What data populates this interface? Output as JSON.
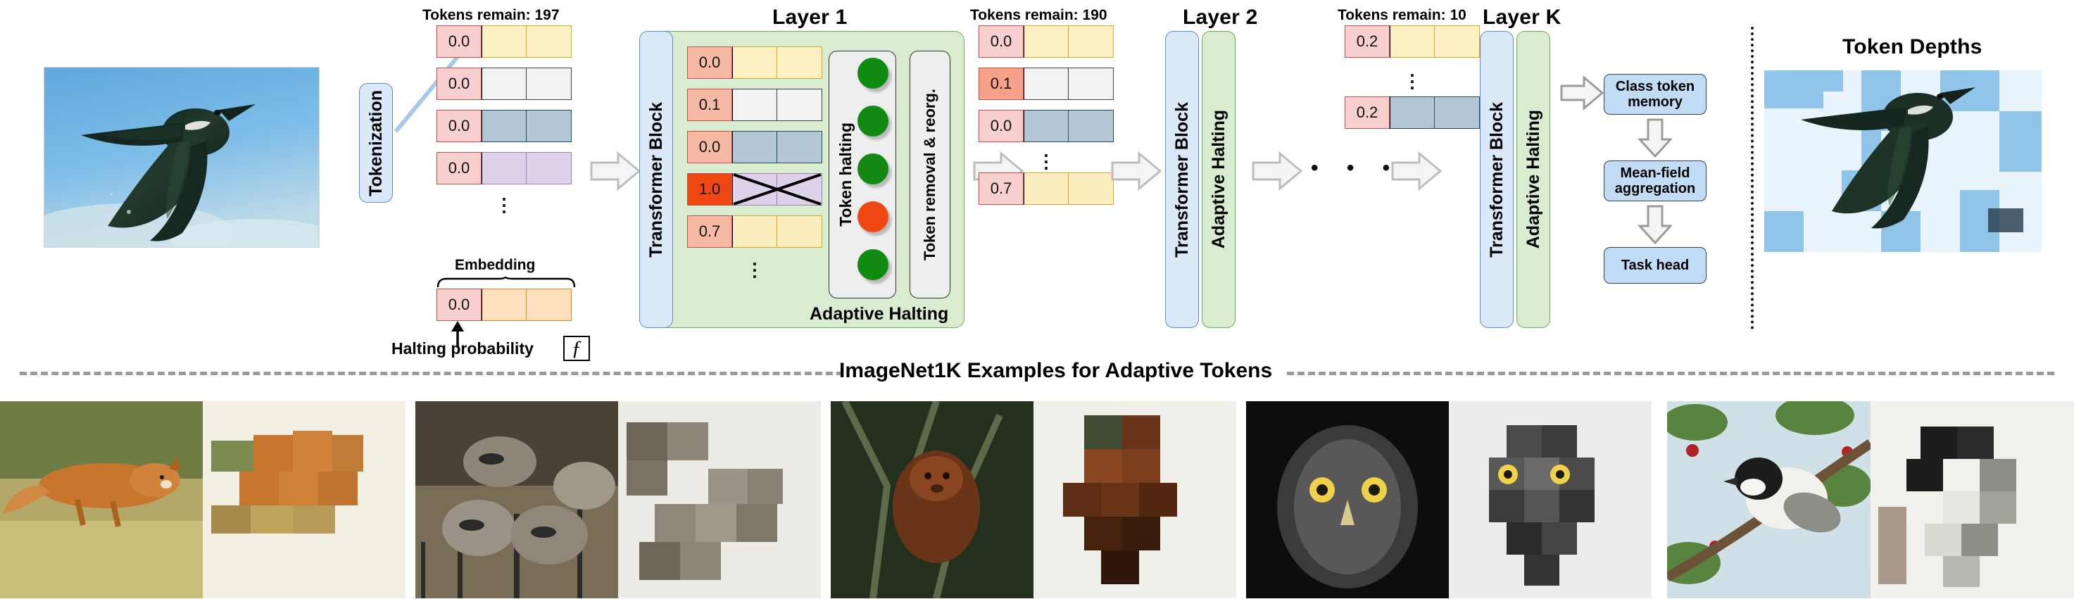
{
  "figure": {
    "bottom_section_title": "ImageNet1K Examples for Adaptive Tokens",
    "token_depths_title": "Token Depths"
  },
  "pipeline": {
    "tokenization_label": "Tokenization",
    "embedding_label": "Embedding",
    "halting_probability_label": "Halting probability",
    "halting_function_icon": "ƒ",
    "stages": [
      {
        "id": "stage-1",
        "tokens_remain": "Tokens remain: 197",
        "tokens": [
          {
            "halt": "0.0",
            "palette": "p-yellow"
          },
          {
            "halt": "0.0",
            "palette": "p-grey"
          },
          {
            "halt": "0.0",
            "palette": "p-blue"
          },
          {
            "halt": "0.0",
            "palette": "p-purple"
          }
        ],
        "ellipsis": "⋮"
      },
      {
        "id": "stage-2",
        "tokens_remain": "Tokens remain: 190",
        "tokens": [
          {
            "halt": "0.0",
            "palette": "p-yellow"
          },
          {
            "halt": "0.1",
            "palette": "p-grey"
          },
          {
            "halt": "0.0",
            "palette": "p-blue"
          },
          {
            "halt": "0.7",
            "palette": "p-yellow2"
          }
        ],
        "ellipsis": "⋮"
      },
      {
        "id": "stage-3",
        "tokens_remain": "Tokens remain: 10",
        "tokens": [
          {
            "halt": "0.2",
            "palette": "p-yellow"
          },
          {
            "halt": "0.2",
            "palette": "p-blue"
          }
        ],
        "ellipsis": "⋮"
      }
    ],
    "layers": [
      {
        "title": "Layer 1",
        "transformer_block_label": "Transformer  Block",
        "token_halting_label": "Token halting",
        "token_removal_label": "Token removal & reorg.",
        "adaptive_halting_label": "Adaptive Halting",
        "tokens": [
          {
            "halt": "0.0",
            "palette": "p-yellow",
            "status": "green",
            "crossed": false
          },
          {
            "halt": "0.1",
            "palette": "p-grey",
            "status": "green",
            "crossed": false
          },
          {
            "halt": "0.0",
            "palette": "p-blue",
            "status": "green",
            "crossed": false
          },
          {
            "halt": "1.0",
            "palette": "p-purple",
            "status": "red",
            "crossed": true
          },
          {
            "halt": "0.7",
            "palette": "p-yellow2",
            "status": "green",
            "crossed": false
          }
        ],
        "ellipsis": "⋮"
      },
      {
        "title": "Layer 2",
        "transformer_block_label": "Transformer  Block",
        "adaptive_halting_label": "Adaptive Halting"
      },
      {
        "title": "Layer K",
        "transformer_block_label": "Transformer  Block",
        "adaptive_halting_label": "Adaptive Halting"
      }
    ],
    "mid_ellipsis": "• • •",
    "head_boxes": [
      {
        "label": "Class token memory"
      },
      {
        "label": "Mean-field aggregation"
      },
      {
        "label": "Task head"
      }
    ]
  },
  "colors": {
    "halting_cell": "#f7cfcf",
    "halting_cell_layer": "#f6b9a3",
    "block_blue": "#dbe8f7",
    "block_green": "#d9ecd0",
    "head_box_blue": "#c3dcf5",
    "green_dot": "#128912",
    "red_dot": "#f04813"
  },
  "examples": [
    {
      "name": "fox-example"
    },
    {
      "name": "raccoon-example"
    },
    {
      "name": "monkey-example"
    },
    {
      "name": "owl-example"
    },
    {
      "name": "chickadee-example"
    }
  ]
}
